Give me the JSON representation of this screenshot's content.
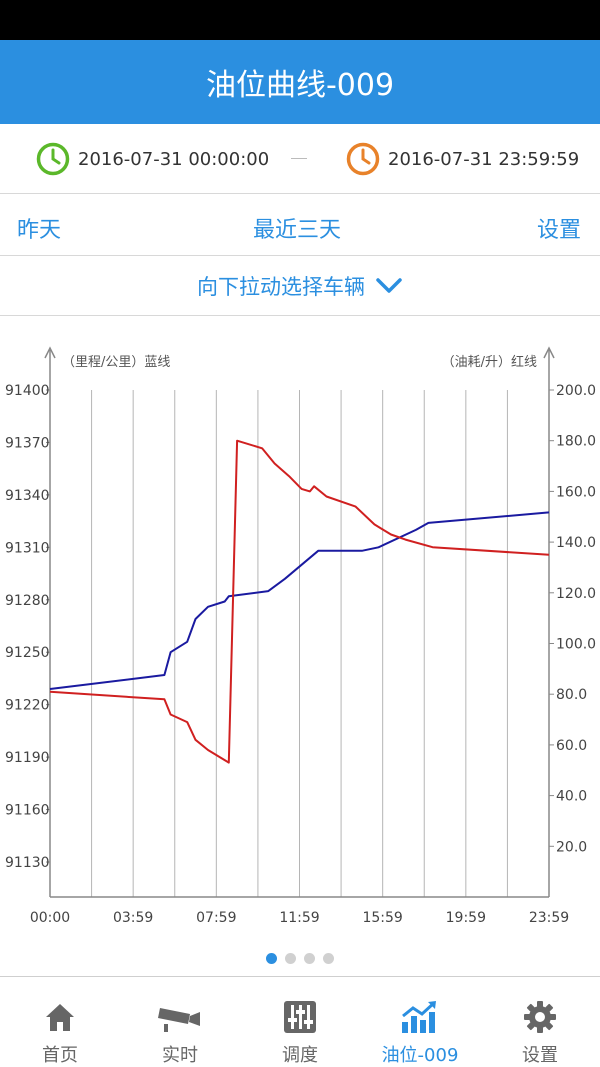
{
  "header": {
    "title": "油位曲线-009"
  },
  "time_range": {
    "start": "2016-07-31 00:00:00",
    "separator": "—",
    "end": "2016-07-31 23:59:59"
  },
  "tabs": {
    "yesterday": "昨天",
    "last_three_days": "最近三天",
    "settings": "设置"
  },
  "vehicle_picker": {
    "label": "向下拉动选择车辆"
  },
  "chart_data": {
    "type": "line",
    "left_axis_label": "（里程/公里）蓝线",
    "right_axis_label": "（油耗/升）红线",
    "x_ticks": [
      "00:00",
      "03:59",
      "07:59",
      "11:59",
      "15:59",
      "19:59",
      "23:59"
    ],
    "left_ticks": [
      "91400",
      "91370",
      "91340",
      "91310",
      "91280",
      "91250",
      "91220",
      "91190",
      "91160",
      "91130"
    ],
    "right_ticks": [
      "200.0",
      "180.0",
      "160.0",
      "140.0",
      "120.0",
      "100.0",
      "80.0",
      "60.0",
      "40.0",
      "20.0"
    ],
    "left_ylim": [
      91110,
      91400
    ],
    "right_ylim": [
      0,
      200
    ],
    "xlim_hours": [
      0,
      24
    ],
    "series": [
      {
        "axis": "left",
        "color": "#1a1aa0",
        "points": [
          [
            0,
            91229
          ],
          [
            5.5,
            91237
          ],
          [
            5.8,
            91250
          ],
          [
            6.6,
            91256
          ],
          [
            7.0,
            91269
          ],
          [
            7.6,
            91276
          ],
          [
            8.4,
            91279
          ],
          [
            8.6,
            91282
          ],
          [
            10.5,
            91285
          ],
          [
            11.3,
            91292
          ],
          [
            12.3,
            91302
          ],
          [
            12.9,
            91308
          ],
          [
            15.0,
            91308
          ],
          [
            15.8,
            91310
          ],
          [
            17.6,
            91320
          ],
          [
            18.2,
            91324
          ],
          [
            24,
            91330
          ]
        ]
      },
      {
        "axis": "right",
        "color": "#d02020",
        "points": [
          [
            0,
            81
          ],
          [
            5.5,
            78
          ],
          [
            5.8,
            72
          ],
          [
            6.6,
            69
          ],
          [
            7.0,
            62
          ],
          [
            7.6,
            58
          ],
          [
            8.4,
            54
          ],
          [
            8.6,
            53
          ],
          [
            9.0,
            180
          ],
          [
            10.2,
            177
          ],
          [
            10.8,
            171
          ],
          [
            11.5,
            166
          ],
          [
            12.1,
            161
          ],
          [
            12.5,
            160
          ],
          [
            12.7,
            162
          ],
          [
            13.3,
            158
          ],
          [
            14.7,
            154
          ],
          [
            15.6,
            147
          ],
          [
            16.4,
            143
          ],
          [
            17.1,
            141
          ],
          [
            18.4,
            138
          ],
          [
            24,
            135
          ]
        ]
      }
    ]
  },
  "pager": {
    "count": 4,
    "active": 0
  },
  "bottom_nav": [
    {
      "label": "首页",
      "icon": "home-icon"
    },
    {
      "label": "实时",
      "icon": "camera-icon"
    },
    {
      "label": "调度",
      "icon": "dispatch-icon"
    },
    {
      "label": "油位-009",
      "icon": "trend-chart-icon",
      "active": true
    },
    {
      "label": "设置",
      "icon": "gear-icon"
    }
  ],
  "colors": {
    "accent": "#2b8fe0",
    "start_clock": "#5bb82a",
    "end_clock": "#e8822a",
    "mileage_line": "#1a1aa0",
    "fuel_line": "#d02020"
  }
}
